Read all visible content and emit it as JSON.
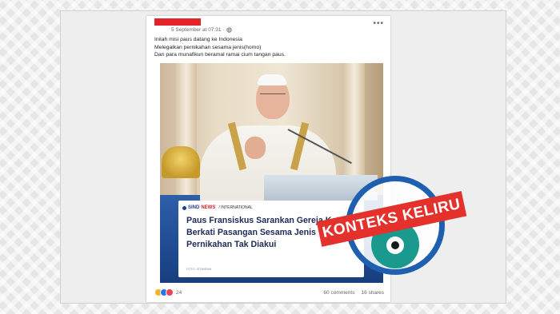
{
  "post": {
    "date": "5 September at 07:31",
    "caption": [
      "Inilah misi paus datang ke Indonesia",
      "Melegalkan pernikahan sesama jenis(homo)",
      "Dan para munafikun beramal ramai cium tangan paus."
    ],
    "reaction_count": "24",
    "comments": "60 comments",
    "shares": "16 shares"
  },
  "news_card": {
    "brand_a": "SIND",
    "brand_b": "NEWS",
    "section": "/ INTERNATIONAL",
    "headline": "Paus Fransiskus Sarankan Gereja Katolik Berkati Pasangan Sesama Jenis Walau Pernikahan Tak Diakui",
    "photo_credit": "FOTO: ISTIMEWA"
  },
  "stamp": {
    "label": "KONTEKS KELIRU"
  },
  "colors": {
    "stamp_red": "#e4312b",
    "stamp_blue": "#1f5fb0",
    "redaction": "#e3242b"
  }
}
